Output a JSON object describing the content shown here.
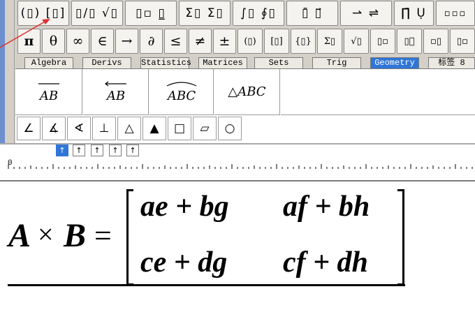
{
  "toolbar_row1": [
    {
      "name": "fence-templates",
      "label": "(▯) [▯]"
    },
    {
      "name": "fraction-radical-templates",
      "label": "▯∕▯ √▯"
    },
    {
      "name": "script-templates",
      "label": "▯▫ ▯̲"
    },
    {
      "name": "summation-templates",
      "label": "Σ▯ Σ▯"
    },
    {
      "name": "integral-templates",
      "label": "∫▯ ∮▯"
    },
    {
      "name": "bar-arrow-templates",
      "label": "▯̄ ▯⃗"
    },
    {
      "name": "labeled-arrow-templates",
      "label": "⇀ ⇌"
    },
    {
      "name": "product-templates",
      "label": "∏̄ Ụ"
    },
    {
      "name": "matrix-templates",
      "label": "▫▫▫"
    }
  ],
  "toolbar_row2": [
    "π",
    "θ",
    "∞",
    "∈",
    "→",
    "∂",
    "≤",
    "≠",
    "±",
    "(▯)",
    "[▯]",
    "{▯}",
    "Σ▯",
    "√▯",
    "▯▫",
    "▯⃞",
    "▫▯"
  ],
  "tabs": [
    "Algebra",
    "Derivs",
    "Statistics",
    "Matrices",
    "Sets",
    "Trig",
    "Geometry",
    "标签 8"
  ],
  "active_tab": "Geometry",
  "geometry_items": [
    {
      "name": "segment",
      "label": "AB"
    },
    {
      "name": "ray",
      "label": "AB"
    },
    {
      "name": "arc",
      "label": "ABC"
    },
    {
      "name": "triangle",
      "label": "△ABC"
    }
  ],
  "angle_symbols": [
    "∠",
    "∡",
    "∢",
    "⊥",
    "△",
    "▲",
    "□",
    "▱",
    "○"
  ],
  "tab_stops": [
    "↑",
    "↑",
    "↑",
    "↑",
    "↑"
  ],
  "ruler": {
    "zero_label": "0"
  },
  "equation": {
    "lhs_a": "A",
    "times": "×",
    "lhs_b": "B",
    "equals": "=",
    "matrix": [
      [
        "ae + bg",
        "af + bh"
      ],
      [
        "ce + dg",
        "cf + dh"
      ]
    ]
  },
  "colors": {
    "accent": "#2f76d6",
    "panel": "#d4d0c8",
    "strip": "#6d8fcf",
    "annotation": "#e03030"
  }
}
